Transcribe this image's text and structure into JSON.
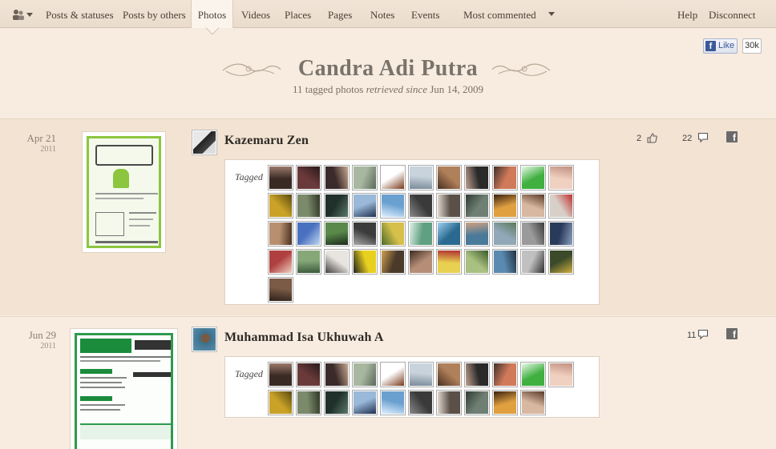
{
  "nav": {
    "items": [
      "Posts & statuses",
      "Posts by others",
      "Photos",
      "Videos",
      "Places",
      "Pages",
      "Notes",
      "Events",
      "Most commented"
    ],
    "help": "Help",
    "disconnect": "Disconnect"
  },
  "like_widget": {
    "button_label": "Like",
    "count": "30k"
  },
  "header": {
    "name": "Candra Adi Putra",
    "subtitle_count": "11 tagged photos",
    "subtitle_retrieved": "retrieved since",
    "subtitle_date": "Jun 14, 2009"
  },
  "posts": [
    {
      "date": "Apr 21",
      "year": "2011",
      "author": "Kazemaru Zen",
      "likes": "2",
      "comments": "22",
      "tagged_label": "Tagged",
      "tag_count": 45
    },
    {
      "date": "Jun 29",
      "year": "2011",
      "author": "Muhammad Isa Ukhuwah A",
      "comments": "11",
      "tagged_label": "Tagged",
      "tag_count": 21
    }
  ],
  "icons": [
    "friends-icon",
    "like-thumb-icon",
    "comment-icon",
    "facebook-icon"
  ],
  "colors": {
    "background": "#f8ece0",
    "nav": "#ece0d2",
    "facebook_blue": "#3b5998"
  }
}
